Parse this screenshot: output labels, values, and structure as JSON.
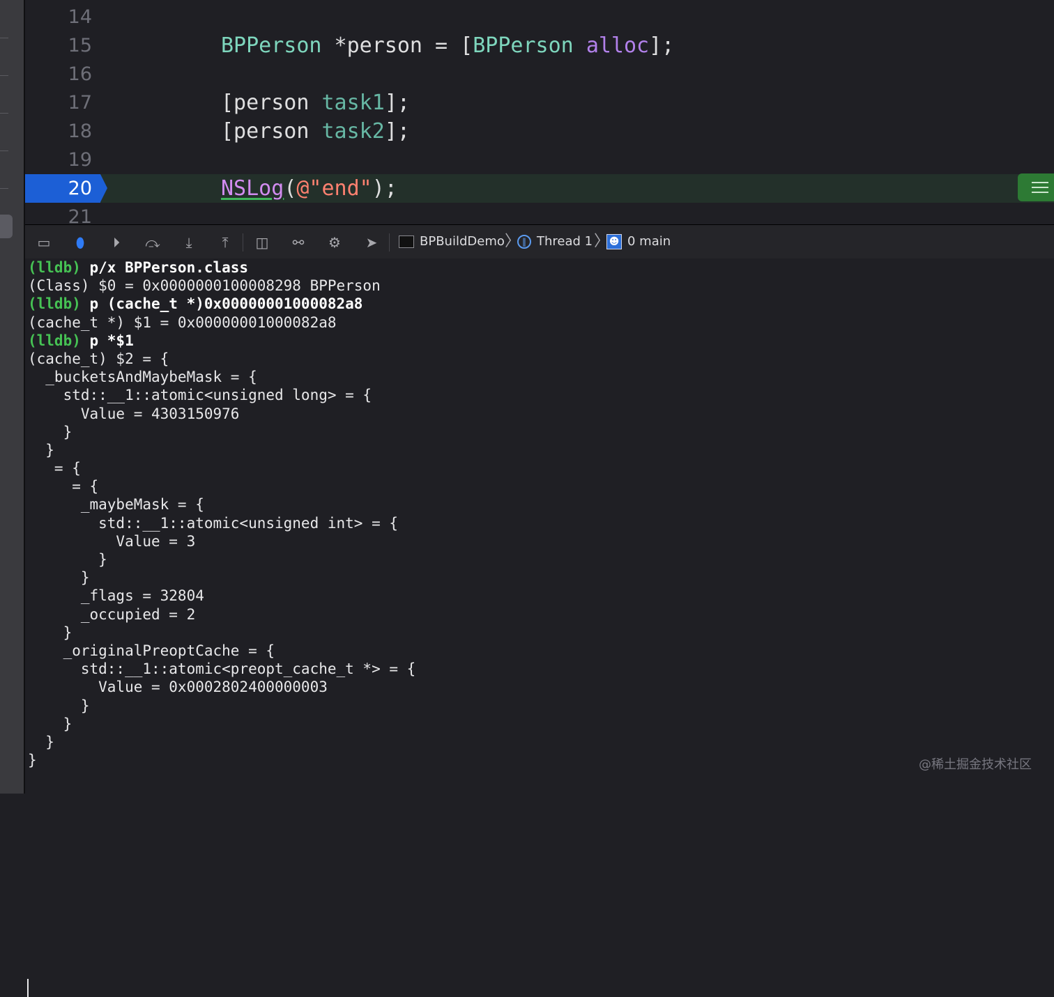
{
  "editor": {
    "lines": [
      {
        "num": "14",
        "tokens": []
      },
      {
        "num": "15",
        "tokens": [
          {
            "t": "BPPerson",
            "k": "t-cls"
          },
          {
            "t": " *person = [",
            "k": ""
          },
          {
            "t": "BPPerson",
            "k": "t-cls"
          },
          {
            "t": " ",
            "k": ""
          },
          {
            "t": "alloc",
            "k": "t-meth"
          },
          {
            "t": "];",
            "k": ""
          }
        ]
      },
      {
        "num": "16",
        "tokens": []
      },
      {
        "num": "17",
        "tokens": [
          {
            "t": "[person ",
            "k": ""
          },
          {
            "t": "task1",
            "k": "t-msg"
          },
          {
            "t": "];",
            "k": ""
          }
        ]
      },
      {
        "num": "18",
        "tokens": [
          {
            "t": "[person ",
            "k": ""
          },
          {
            "t": "task2",
            "k": "t-msg"
          },
          {
            "t": "];",
            "k": ""
          }
        ]
      },
      {
        "num": "19",
        "tokens": []
      },
      {
        "num": "20",
        "current": true,
        "tokens": [
          {
            "t": "NSLog",
            "k": "t-fn"
          },
          {
            "t": "(",
            "k": ""
          },
          {
            "t": "@\"end\"",
            "k": "t-str"
          },
          {
            "t": ");",
            "k": ""
          }
        ]
      },
      {
        "num": "21",
        "tokens": []
      }
    ]
  },
  "debug_bar": {
    "buttons": [
      {
        "name": "hide-debug-area-icon",
        "glyph": "▭"
      },
      {
        "name": "breakpoints-toggle-icon",
        "glyph": "⬮"
      },
      {
        "name": "continue-icon",
        "glyph": "⏵"
      },
      {
        "name": "step-over-icon",
        "glyph": "⤼"
      },
      {
        "name": "step-into-icon",
        "glyph": "⤓"
      },
      {
        "name": "step-out-icon",
        "glyph": "⤒"
      },
      {
        "name": "view-hierarchy-icon",
        "glyph": "◫"
      },
      {
        "name": "memory-graph-icon",
        "glyph": "⚯"
      },
      {
        "name": "environment-overrides-icon",
        "glyph": "⚙"
      },
      {
        "name": "simulate-location-icon",
        "glyph": "➤"
      }
    ],
    "breadcrumb": {
      "app": "BPBuildDemo",
      "thread": "Thread 1",
      "frame": "0 main"
    }
  },
  "console": {
    "lines": [
      {
        "prompt": "(lldb)",
        "text": " p/x BPPerson.class"
      },
      {
        "text": "(Class) $0 = 0x0000000100008298 BPPerson"
      },
      {
        "prompt": "(lldb)",
        "text": " p (cache_t *)0x00000001000082a8"
      },
      {
        "text": "(cache_t *) $1 = 0x00000001000082a8"
      },
      {
        "prompt": "(lldb)",
        "text": " p *$1"
      },
      {
        "text": "(cache_t) $2 = {"
      },
      {
        "text": "  _bucketsAndMaybeMask = {"
      },
      {
        "text": "    std::__1::atomic<unsigned long> = {"
      },
      {
        "text": "      Value = 4303150976"
      },
      {
        "text": "    }"
      },
      {
        "text": "  }"
      },
      {
        "text": "   = {"
      },
      {
        "text": "     = {"
      },
      {
        "text": "      _maybeMask = {"
      },
      {
        "text": "        std::__1::atomic<unsigned int> = {"
      },
      {
        "text": "          Value = 3"
      },
      {
        "text": "        }"
      },
      {
        "text": "      }"
      },
      {
        "text": "      _flags = 32804"
      },
      {
        "text": "      _occupied = 2"
      },
      {
        "text": "    }"
      },
      {
        "text": "    _originalPreoptCache = {"
      },
      {
        "text": "      std::__1::atomic<preopt_cache_t *> = {"
      },
      {
        "text": "        Value = 0x0002802400000003"
      },
      {
        "text": "      }"
      },
      {
        "text": "    }"
      },
      {
        "text": "  }"
      },
      {
        "text": "}"
      }
    ]
  },
  "watermark": "@稀土掘金技术社区"
}
